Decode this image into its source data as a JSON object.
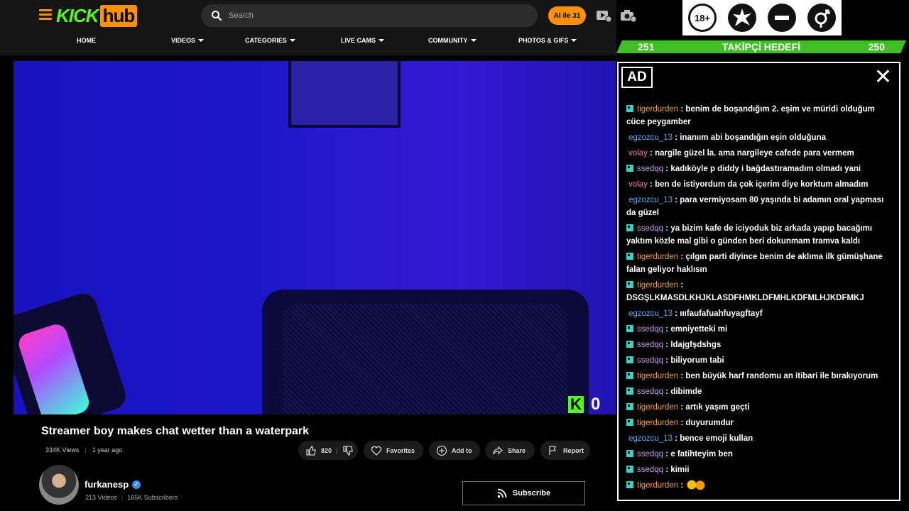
{
  "header": {
    "logo_left": "KICK",
    "logo_right": "hub",
    "search_placeholder": "Search",
    "ai_button": "AI ile 31"
  },
  "nav": [
    {
      "label": "HOME"
    },
    {
      "label": "VIDEOS"
    },
    {
      "label": "CATEGORIES"
    },
    {
      "label": "LIVE CAMS"
    },
    {
      "label": "COMMUNITY"
    },
    {
      "label": "PHOTOS & GIFS"
    }
  ],
  "badges": [
    "18+",
    "",
    "",
    ""
  ],
  "goal": {
    "left": "251",
    "label": "TAKİPÇİ HEDEFİ",
    "right": "250"
  },
  "video": {
    "kick_letter": "K",
    "viewer_count": "0",
    "title": "Streamer boy makes chat wetter than a waterpark",
    "views": "334K Views",
    "age": "1 year ago",
    "likes": "820",
    "favorites": "Favorites",
    "add_to": "Add to",
    "share": "Share",
    "report": "Report"
  },
  "channel": {
    "name": "furkanesp",
    "videos": "213 Videos",
    "subscribers": "165K Subscribers",
    "subscribe": "Subscribe"
  },
  "chat": {
    "ad_label": "AD",
    "close": "✕",
    "messages": [
      {
        "user": "tigerdurden",
        "text": "benim de boşandığım 2. eşim ve müridi olduğum cüce peygamber",
        "badge": true
      },
      {
        "user": "egzozcu_13",
        "text": "inanıım abi boşandığın eşin olduğuna",
        "badge": false
      },
      {
        "user": "volay",
        "text": "nargile güzel la. ama nargileye cafede para vermem",
        "badge": false
      },
      {
        "user": "ssedqq",
        "text": "kadıköyle p diddy i bağdastıramadım olmadı yani",
        "badge": true
      },
      {
        "user": "volay",
        "text": "ben de istiyordum da çok içerim diye korktum almadım",
        "badge": false
      },
      {
        "user": "egzozcu_13",
        "text": "para vermiyosam 80 yaşında bi adamın oral yapması da güzel",
        "badge": false
      },
      {
        "user": "ssedqq",
        "text": "ya bizim kafe de iciyoduk biz arkada yapıp bacağımı yaktım közle mal gibi o günden beri dokunmam tramva kaldı",
        "badge": true
      },
      {
        "user": "tigerdurden",
        "text": "çılgın parti diyince benim de aklıma ilk gümüşhane falan geliyor haklısın",
        "badge": true
      },
      {
        "user": "tigerdurden",
        "text": "DSGŞLKMASDLKHJKLASDFHMKLDFMHLKDFMLHJKDFMKJ",
        "badge": true
      },
      {
        "user": "egzozcu_13",
        "text": "ıııfaufafuahfuyagftayf",
        "badge": false
      },
      {
        "user": "ssedqq",
        "text": "emniyetteki mi",
        "badge": true
      },
      {
        "user": "ssedqq",
        "text": "ldajgfşdshgs",
        "badge": true
      },
      {
        "user": "ssedqq",
        "text": "biliyorum tabi",
        "badge": true
      },
      {
        "user": "tigerdurden",
        "text": "ben büyük harf randomu an itibari ile bırakıyorum",
        "badge": true
      },
      {
        "user": "ssedqq",
        "text": "dibimde",
        "badge": true
      },
      {
        "user": "tigerdurden",
        "text": "artık yaşım geçti",
        "badge": true
      },
      {
        "user": "tigerdurden",
        "text": "duyurumdur",
        "badge": true
      },
      {
        "user": "egzozcu_13",
        "text": "bence emoji kullan",
        "badge": false
      },
      {
        "user": "ssedqq",
        "text": "e fatihteyim ben",
        "badge": true
      },
      {
        "user": "ssedqq",
        "text": "kimii",
        "badge": true
      },
      {
        "user": "tigerdurden",
        "text": "",
        "badge": true,
        "emoji": true
      }
    ]
  },
  "colors": {
    "accent": "#ff9000",
    "kick_green": "#53fc18",
    "goal_green": "#3fbf24"
  }
}
